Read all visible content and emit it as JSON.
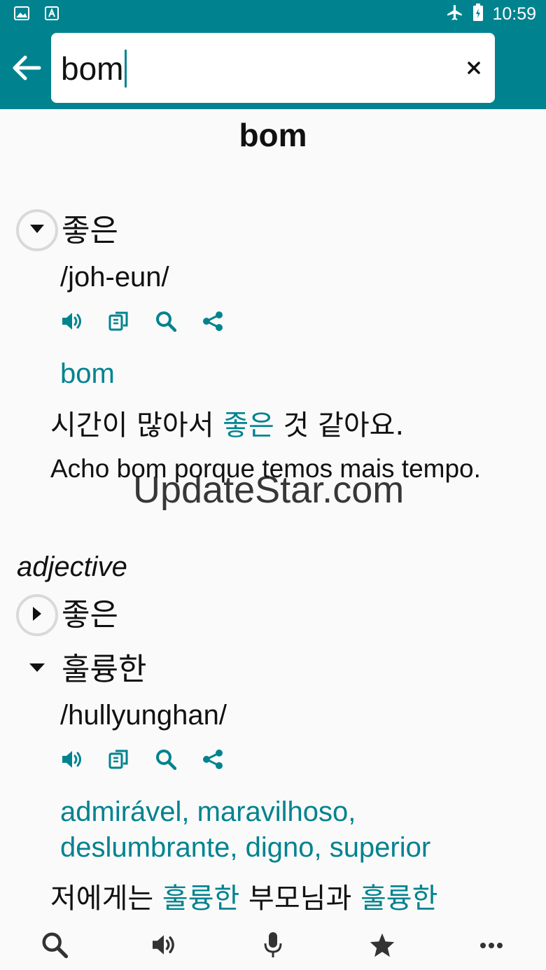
{
  "status_bar": {
    "time": "10:59"
  },
  "search": {
    "query": "bom"
  },
  "headword": "bom",
  "entries": [
    {
      "korean": "좋은",
      "pronunciation": "/joh-eun/",
      "translation": "bom",
      "example_ko": {
        "before": "시간이 많아서 ",
        "highlight": "좋은",
        "after": " 것 같아요."
      },
      "example_pt": "Acho bom porque temos mais tempo."
    }
  ],
  "part_of_speech": "adjective",
  "adjective_entries": [
    {
      "korean": "좋은"
    },
    {
      "korean": "훌륭한",
      "pronunciation": "/hullyunghan/",
      "translation_line1": "admirável, maravilhoso,",
      "translation_line2": "deslumbrante, digno, superior",
      "example_ko": {
        "part1": "저에게는 ",
        "hl1": "훌륭한",
        "part2": " 부모님과 ",
        "hl2": "훌륭한"
      }
    }
  ],
  "watermark": "UpdateStar.com",
  "icons": [
    "image-icon",
    "translate-icon",
    "airplane-icon",
    "battery-icon",
    "back-arrow-icon",
    "close-icon",
    "speaker-icon",
    "copy-icon",
    "search-icon",
    "share-icon",
    "microphone-icon",
    "star-icon",
    "more-icon"
  ],
  "colors": {
    "primary": "#00838f",
    "background": "#fafafa",
    "text": "#111111"
  }
}
